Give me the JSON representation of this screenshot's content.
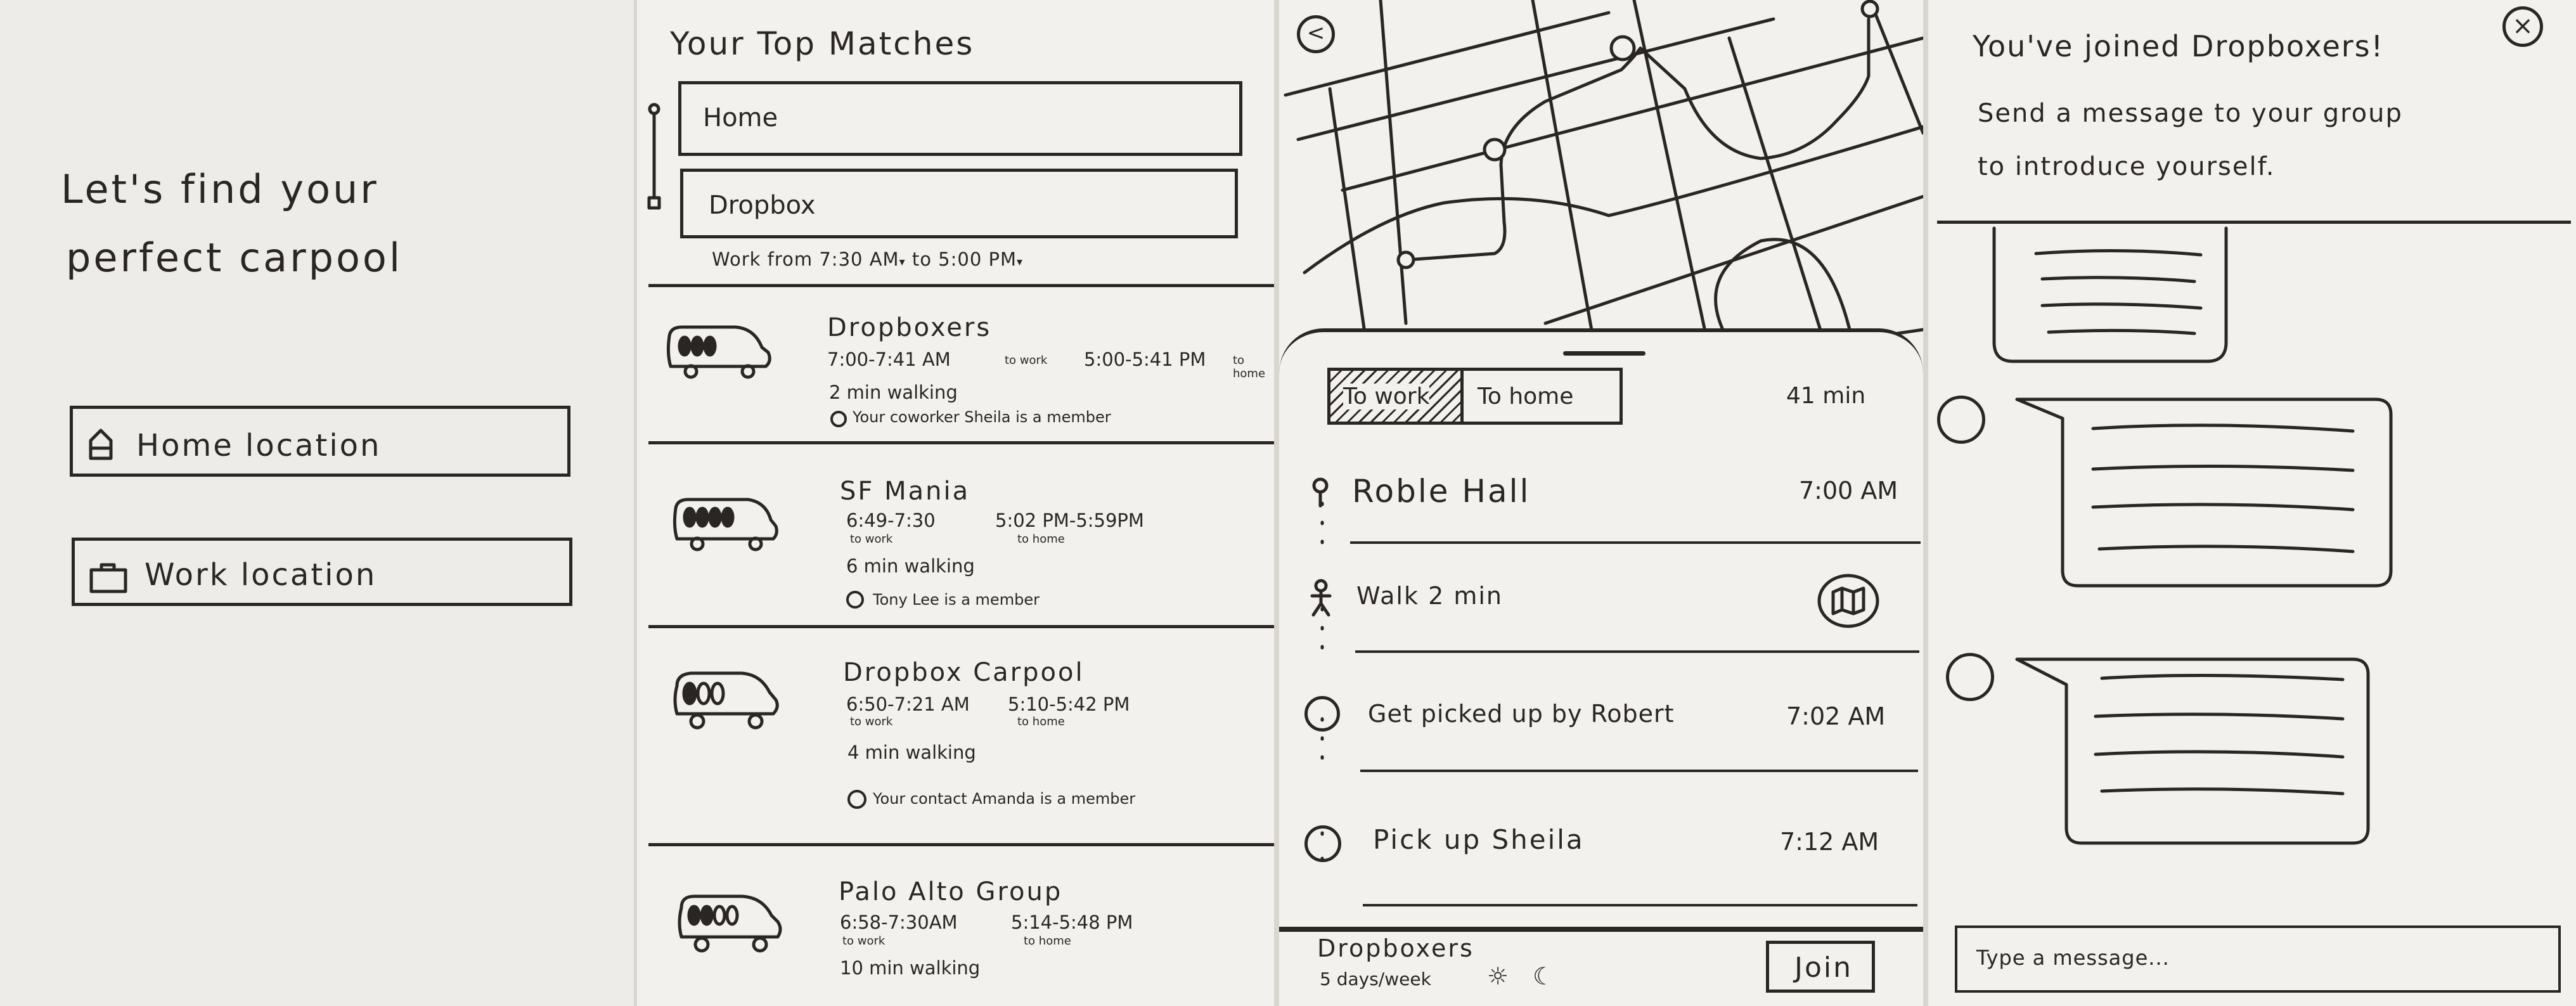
{
  "screen1": {
    "headline_line1": "Let's find your",
    "headline_line2": "perfect carpool",
    "home_button": "Home location",
    "work_button": "Work location"
  },
  "screen2": {
    "title": "Your Top Matches",
    "home_field": "Home",
    "work_field": "Dropbox",
    "hours_text": "Work from 7:30 AM",
    "hours_to": "to",
    "hours_end": "5:00 PM",
    "groups": [
      {
        "name": "Dropboxers",
        "to_work": "7:00-7:41 AM",
        "to_work_label": "to work",
        "to_home": "5:00-5:41 PM",
        "to_home_label": "to home",
        "walking": "2 min walking",
        "member_note": "Your coworker Sheila is a member"
      },
      {
        "name": "SF Mania",
        "to_work": "6:49-7:30",
        "to_work_label": "to work",
        "to_home": "5:02 PM-5:59PM",
        "to_home_label": "to home",
        "walking": "6 min walking",
        "member_note": "Tony Lee is a member"
      },
      {
        "name": "Dropbox Carpool",
        "to_work": "6:50-7:21 AM",
        "to_work_label": "to work",
        "to_home": "5:10-5:42 PM",
        "to_home_label": "to home",
        "walking": "4 min walking",
        "member_note": "Your contact Amanda is a member"
      },
      {
        "name": "Palo Alto Group",
        "to_work": "6:58-7:30AM",
        "to_work_label": "to work",
        "to_home": "5:14-5:48 PM",
        "to_home_label": "to home",
        "walking": "10 min walking",
        "member_note": ""
      }
    ]
  },
  "screen3": {
    "tab_to_work": "To work",
    "tab_to_home": "To home",
    "duration": "41 min",
    "steps": [
      {
        "label": "Roble Hall",
        "time": "7:00 AM"
      },
      {
        "label": "Walk 2 min",
        "time": ""
      },
      {
        "label": "Get picked up by Robert",
        "time": "7:02 AM"
      },
      {
        "label": "Pick up Sheila",
        "time": "7:12 AM"
      }
    ],
    "group_name": "Dropboxers",
    "schedule": "5 days/week",
    "join_button": "Join"
  },
  "screen4": {
    "joined_title": "You've joined Dropboxers!",
    "prompt_line1": "Send a message to your group",
    "prompt_line2": "to introduce yourself.",
    "message_placeholder": "Type a message..."
  }
}
